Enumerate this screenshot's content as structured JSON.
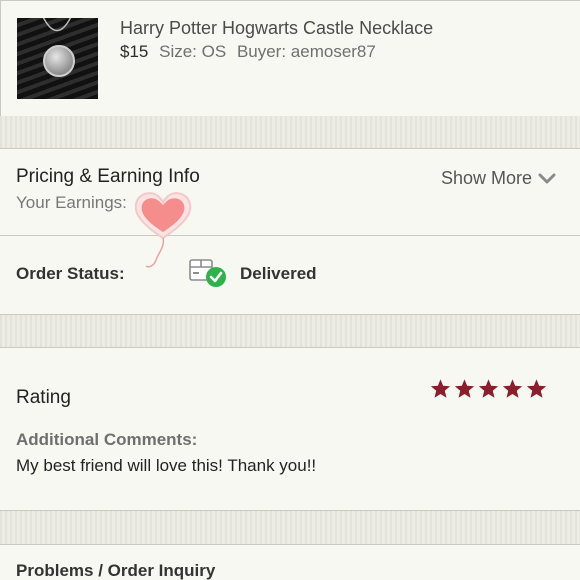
{
  "product": {
    "title": "Harry Potter Hogwarts Castle Necklace",
    "price": "$15",
    "size": "Size: OS",
    "buyer": "Buyer: aemoser87",
    "image_icon": "necklace-photo"
  },
  "pricing": {
    "title": "Pricing & Earning Info",
    "earnings_label": "Your Earnings:",
    "show_more": "Show More",
    "sticker_icon": "heart-balloon-icon"
  },
  "order_status": {
    "label": "Order Status:",
    "value": "Delivered",
    "status_color": "#2db34a"
  },
  "rating": {
    "title": "Rating",
    "stars": 5,
    "max_stars": 5,
    "star_color": "#8b1e2a",
    "comments_label": "Additional Comments:",
    "comments_text": "My best friend will love this! Thank you!!"
  },
  "problems": {
    "title": "Problems / Order Inquiry"
  }
}
